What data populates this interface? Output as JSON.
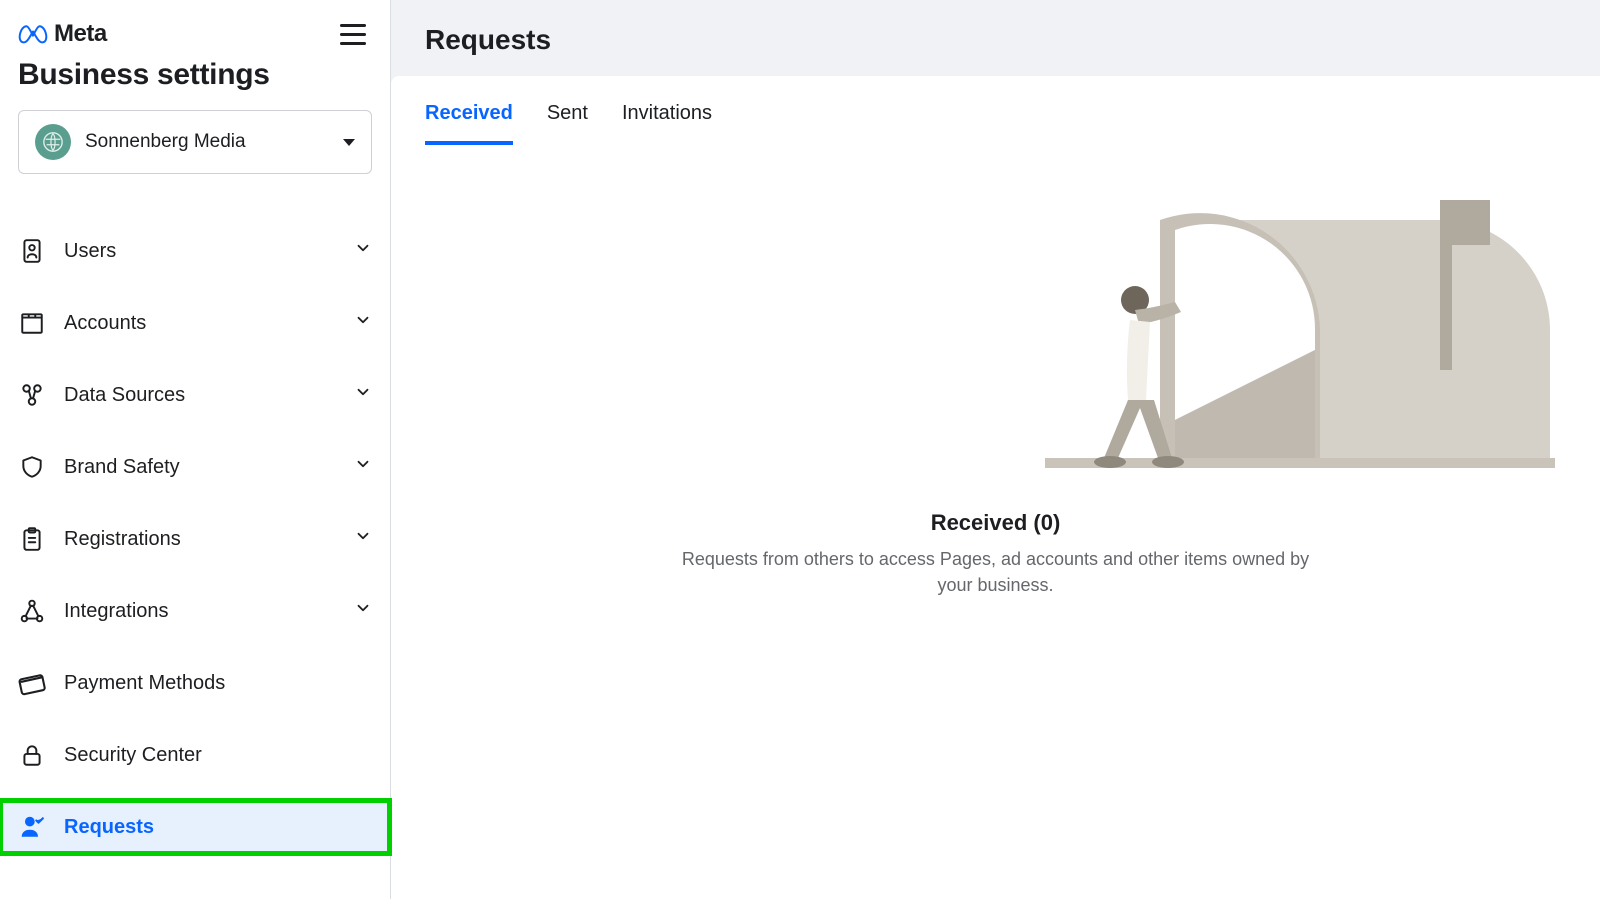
{
  "brand": {
    "name": "Meta"
  },
  "sidebar": {
    "title": "Business settings",
    "account": {
      "name": "Sonnenberg Media"
    },
    "items": [
      {
        "label": "Users",
        "icon": "users-icon",
        "expandable": true
      },
      {
        "label": "Accounts",
        "icon": "accounts-icon",
        "expandable": true
      },
      {
        "label": "Data Sources",
        "icon": "data-sources-icon",
        "expandable": true
      },
      {
        "label": "Brand Safety",
        "icon": "shield-icon",
        "expandable": true
      },
      {
        "label": "Registrations",
        "icon": "clipboard-icon",
        "expandable": true
      },
      {
        "label": "Integrations",
        "icon": "integrations-icon",
        "expandable": true
      },
      {
        "label": "Payment Methods",
        "icon": "card-icon",
        "expandable": false
      },
      {
        "label": "Security Center",
        "icon": "lock-icon",
        "expandable": false
      },
      {
        "label": "Requests",
        "icon": "person-check-icon",
        "expandable": false,
        "active": true
      }
    ]
  },
  "main": {
    "header": "Requests",
    "tabs": [
      {
        "label": "Received",
        "active": true
      },
      {
        "label": "Sent",
        "active": false
      },
      {
        "label": "Invitations",
        "active": false
      }
    ],
    "empty": {
      "title": "Received (0)",
      "subtitle": "Requests from others to access Pages, ad accounts and other items owned by your business."
    }
  }
}
